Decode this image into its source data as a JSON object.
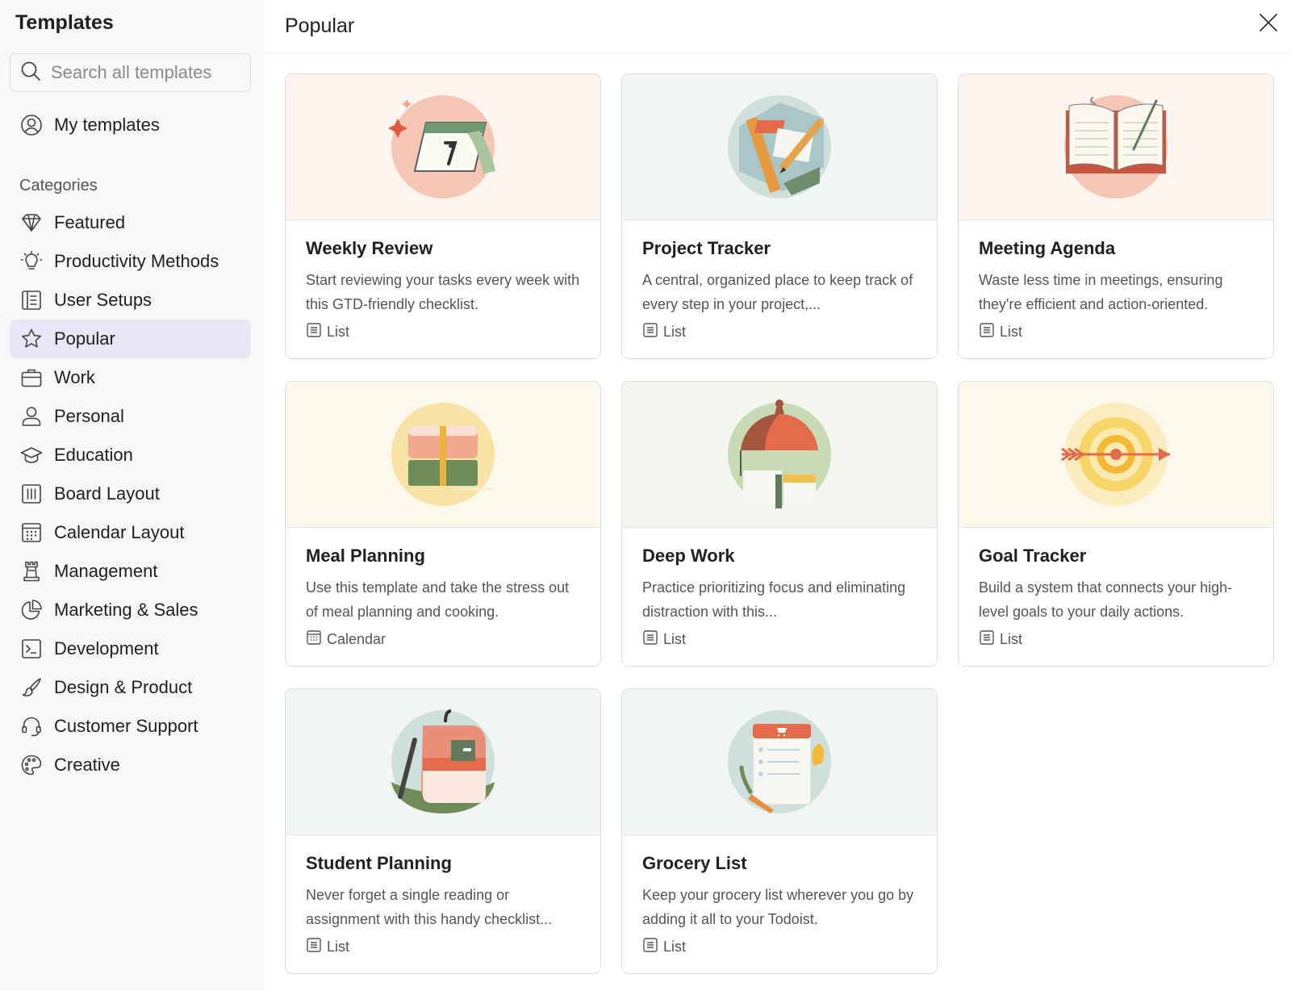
{
  "sidebar": {
    "title": "Templates",
    "search_placeholder": "Search all templates",
    "my_templates": "My templates",
    "categories_heading": "Categories",
    "items": [
      {
        "label": "Featured",
        "icon": "diamond-icon"
      },
      {
        "label": "Productivity Methods",
        "icon": "lightbulb-icon"
      },
      {
        "label": "User Setups",
        "icon": "layout-list-icon"
      },
      {
        "label": "Popular",
        "icon": "star-icon",
        "active": true
      },
      {
        "label": "Work",
        "icon": "briefcase-icon"
      },
      {
        "label": "Personal",
        "icon": "person-icon"
      },
      {
        "label": "Education",
        "icon": "graduation-cap-icon"
      },
      {
        "label": "Board Layout",
        "icon": "board-icon"
      },
      {
        "label": "Calendar Layout",
        "icon": "calendar-icon"
      },
      {
        "label": "Management",
        "icon": "chess-rook-icon"
      },
      {
        "label": "Marketing & Sales",
        "icon": "pie-chart-icon"
      },
      {
        "label": "Development",
        "icon": "terminal-icon"
      },
      {
        "label": "Design & Product",
        "icon": "paintbrush-icon"
      },
      {
        "label": "Customer Support",
        "icon": "headset-icon"
      },
      {
        "label": "Creative",
        "icon": "palette-icon"
      }
    ]
  },
  "main": {
    "title": "Popular",
    "close_icon": "close-icon",
    "cards": [
      {
        "title": "Weekly Review",
        "description": "Start reviewing your tasks every week with this GTD-friendly checklist.",
        "type": "List",
        "art_bg": "#fdf3ef",
        "art": "calendar-illustration"
      },
      {
        "title": "Project Tracker",
        "description": "A central, organized place to keep track of every step in your project,...",
        "type": "List",
        "art_bg": "#f1f6f3",
        "art": "blueprint-illustration"
      },
      {
        "title": "Meeting Agenda",
        "description": "Waste less time in meetings, ensuring they're efficient and action-oriented.",
        "type": "List",
        "art_bg": "#fdf3ef",
        "art": "notebook-illustration"
      },
      {
        "title": "Meal Planning",
        "description": "Use this template and take the stress out of meal planning and cooking.",
        "type": "Calendar",
        "art_bg": "#fcf8ec",
        "art": "lunchbox-illustration"
      },
      {
        "title": "Deep Work",
        "description": "Practice prioritizing focus and eliminating distraction with this...",
        "type": "List",
        "art_bg": "#f3f6ef",
        "art": "lamp-illustration"
      },
      {
        "title": "Goal Tracker",
        "description": "Build a system that connects your high-level goals to your daily actions.",
        "type": "List",
        "art_bg": "#fcf8ec",
        "art": "target-illustration"
      },
      {
        "title": "Student Planning",
        "description": "Never forget a single reading or assignment with this handy checklist...",
        "type": "List",
        "art_bg": "#f1f6f3",
        "art": "backpack-illustration"
      },
      {
        "title": "Grocery List",
        "description": "Keep your grocery list wherever you go by adding it all to your Todoist.",
        "type": "List",
        "art_bg": "#f1f6f3",
        "art": "grocery-illustration"
      }
    ]
  },
  "colors": {
    "active_bg": "#e9e6f6",
    "sidebar_bg": "#f8f8f8",
    "accent": "#db4c3f"
  }
}
